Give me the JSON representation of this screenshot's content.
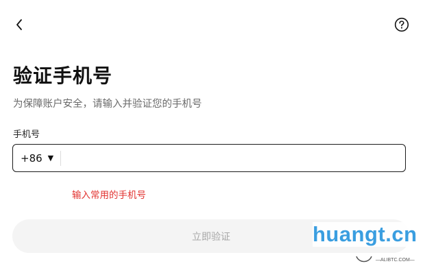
{
  "header": {
    "back_icon": "chevron-left-icon",
    "help_icon": "question-circle-icon"
  },
  "page": {
    "title": "验证手机号",
    "subtitle": "为保障账户安全，请输入并验证您的手机号"
  },
  "form": {
    "phone_label": "手机号",
    "country_code": "+86",
    "phone_value": "",
    "phone_placeholder": "",
    "error_text": "输入常用的手机号",
    "submit_label": "立即验证",
    "submit_enabled": false
  },
  "colors": {
    "error": "#e2322f",
    "watermark": "#3a9ee0",
    "disabled_button_bg": "#f4f4f4",
    "disabled_button_text": "#a8a8a8"
  },
  "watermark": {
    "text": "huangt.cn",
    "sub": "—ALIBTC.COM—"
  }
}
